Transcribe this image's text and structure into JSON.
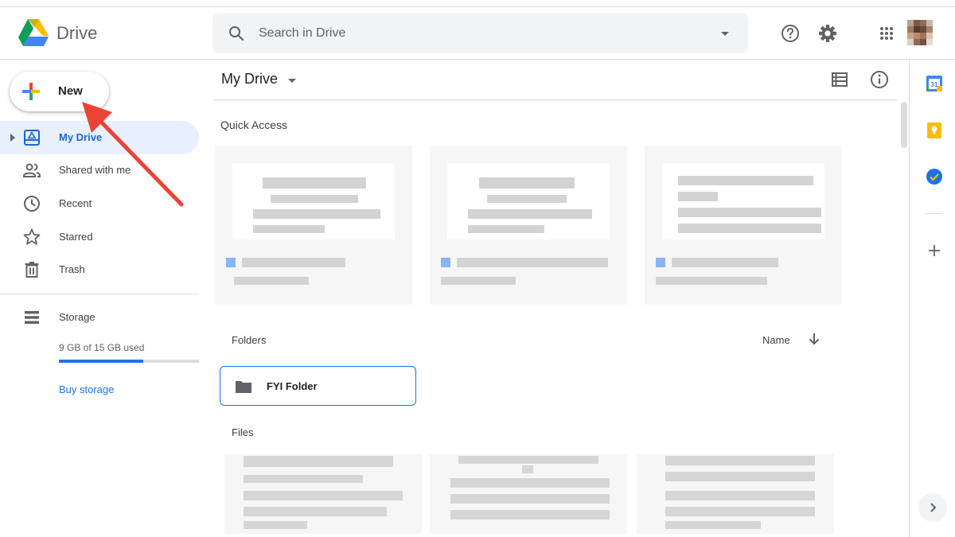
{
  "header": {
    "app_title": "Drive",
    "search_placeholder": "Search in Drive",
    "icons": [
      "drive-logo-icon",
      "search-icon",
      "search-options-caret-icon",
      "help-icon",
      "settings-icon",
      "apps-grid-icon",
      "avatar"
    ]
  },
  "sidebar": {
    "new_label": "New",
    "items": [
      {
        "label": "My Drive",
        "icon": "my-drive-icon",
        "active": true
      },
      {
        "label": "Shared with me",
        "icon": "shared-with-me-icon"
      },
      {
        "label": "Recent",
        "icon": "recent-clock-icon"
      },
      {
        "label": "Starred",
        "icon": "star-icon"
      },
      {
        "label": "Trash",
        "icon": "trash-icon"
      }
    ],
    "storage": {
      "label": "Storage",
      "usage_text": "9 GB of 15 GB used",
      "used_fraction": 0.6,
      "buy_label": "Buy storage"
    }
  },
  "main": {
    "title": "My Drive",
    "quick_access_label": "Quick Access",
    "folders_label": "Folders",
    "sort_label": "Name",
    "folders": [
      {
        "name": "FYI Folder"
      }
    ],
    "files_label": "Files"
  },
  "side_panel": {
    "icons": [
      "calendar-icon",
      "keep-icon",
      "tasks-icon",
      "add-addon-icon",
      "expand-panel-icon"
    ],
    "calendar_day": "31"
  },
  "colors": {
    "accent": "#1a73e8",
    "active_nav_bg": "#e8f0fe",
    "arrow": "#ea4335"
  }
}
